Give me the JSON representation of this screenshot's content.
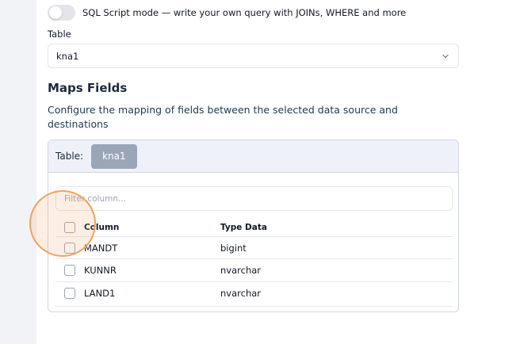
{
  "sql_mode": {
    "label": "SQL Script mode — write your own query with JOINs, WHERE and more",
    "enabled": false
  },
  "table_field": {
    "label": "Table",
    "selected": "kna1",
    "chevron_icon": "chevron-down-icon"
  },
  "maps_fields": {
    "title": "Maps Fields",
    "description": "Configure the mapping of fields between the selected data source and destinations",
    "card": {
      "header_label": "Table:",
      "table_chip": "kna1",
      "filter_placeholder": "Filter column...",
      "columns": {
        "name": "Column",
        "type": "Type Data"
      },
      "rows": [
        {
          "column": "MANDT",
          "type": "bigint",
          "checked": false
        },
        {
          "column": "KUNNR",
          "type": "nvarchar",
          "checked": false
        },
        {
          "column": "LAND1",
          "type": "nvarchar",
          "checked": false
        }
      ]
    }
  },
  "colors": {
    "accent_ring": "#f0a35e",
    "chip_bg": "#9aa6b8",
    "card_header_bg": "#eef1f8"
  }
}
